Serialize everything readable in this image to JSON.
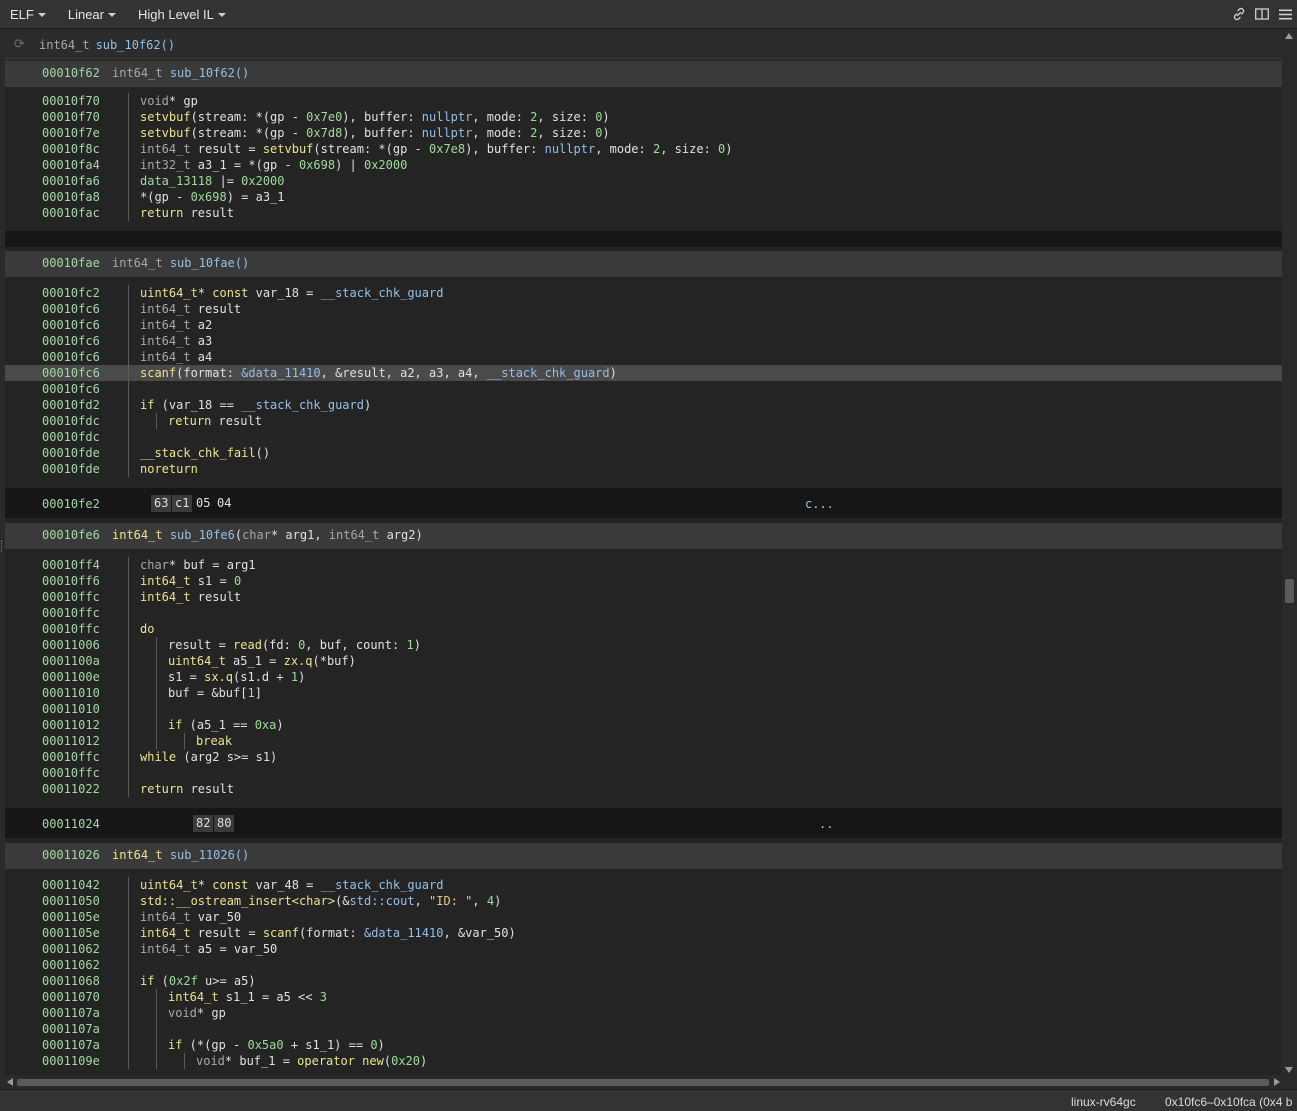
{
  "toolbar": {
    "menus": [
      {
        "label": "ELF"
      },
      {
        "label": "Linear"
      },
      {
        "label": "High Level IL"
      }
    ],
    "icons": [
      "link-icon",
      "split-view-icon",
      "hamburger-menu-icon"
    ]
  },
  "header": {
    "type": "int64_t",
    "name": "sub_10f62()"
  },
  "status": {
    "platform": "linux-rv64gc",
    "range": "0x10fc6–0x10fca (0x4 b"
  },
  "func1": {
    "addr": "00010f62",
    "ret": "int64_t",
    "name": "sub_10f62()",
    "lines": [
      {
        "addr": "00010f70"
      },
      {
        "addr": "00010f70"
      },
      {
        "addr": "00010f7e"
      },
      {
        "addr": "00010f8c"
      },
      {
        "addr": "00010fa4"
      },
      {
        "addr": "00010fa6"
      },
      {
        "addr": "00010fa8"
      },
      {
        "addr": "00010fac"
      }
    ]
  },
  "func2": {
    "addr": "00010fae",
    "ret": "int64_t",
    "name": "sub_10fae()",
    "lines": [
      {
        "addr": "00010fc2"
      },
      {
        "addr": "00010fc6"
      },
      {
        "addr": "00010fc6"
      },
      {
        "addr": "00010fc6"
      },
      {
        "addr": "00010fc6"
      },
      {
        "addr": "00010fc6"
      },
      {
        "addr": "00010fc6"
      },
      {
        "addr": "00010fd2"
      },
      {
        "addr": "00010fdc"
      },
      {
        "addr": "00010fdc"
      },
      {
        "addr": "00010fde"
      },
      {
        "addr": "00010fde"
      }
    ]
  },
  "data1": {
    "addr": "00010fe2",
    "bytes": [
      "63",
      "c1",
      "05",
      "04"
    ],
    "ascii": "c..."
  },
  "func3": {
    "addr": "00010fe6",
    "ret": "int64_t",
    "name": "sub_10fe6",
    "lines": [
      {
        "addr": "00010ff4"
      },
      {
        "addr": "00010ff6"
      },
      {
        "addr": "00010ffc"
      },
      {
        "addr": "00010ffc"
      },
      {
        "addr": "00010ffc"
      },
      {
        "addr": "00011006"
      },
      {
        "addr": "0001100a"
      },
      {
        "addr": "0001100e"
      },
      {
        "addr": "00011010"
      },
      {
        "addr": "00011010"
      },
      {
        "addr": "00011012"
      },
      {
        "addr": "00011012"
      },
      {
        "addr": "00010ffc"
      },
      {
        "addr": "00010ffc"
      },
      {
        "addr": "00011022"
      }
    ]
  },
  "data2": {
    "addr": "00011024",
    "bytes": [
      "82",
      "80"
    ],
    "ascii": ".."
  },
  "func4": {
    "addr": "00011026",
    "ret": "int64_t",
    "name": "sub_11026()",
    "lines": [
      {
        "addr": "00011042"
      },
      {
        "addr": "00011050"
      },
      {
        "addr": "0001105e"
      },
      {
        "addr": "0001105e"
      },
      {
        "addr": "00011062"
      },
      {
        "addr": "00011062"
      },
      {
        "addr": "00011068"
      },
      {
        "addr": "00011070"
      },
      {
        "addr": "0001107a"
      },
      {
        "addr": "0001107a"
      },
      {
        "addr": "0001107a"
      },
      {
        "addr": "0001109e"
      }
    ]
  },
  "code": {
    "f1": [
      [
        [
          "t-type",
          "void"
        ],
        [
          "",
          "* gp"
        ]
      ],
      [
        [
          "t-func",
          "setvbuf"
        ],
        [
          "",
          "(stream: *(gp - "
        ],
        [
          "t-num",
          "0x7e0"
        ],
        [
          "",
          "), buffer: "
        ],
        [
          "t-data",
          "nullptr"
        ],
        [
          "",
          ", mode: "
        ],
        [
          "t-num",
          "2"
        ],
        [
          "",
          ", size: "
        ],
        [
          "t-num",
          "0"
        ],
        [
          "",
          ")"
        ]
      ],
      [
        [
          "t-func",
          "setvbuf"
        ],
        [
          "",
          "(stream: *(gp - "
        ],
        [
          "t-num",
          "0x7d8"
        ],
        [
          "",
          "), buffer: "
        ],
        [
          "t-data",
          "nullptr"
        ],
        [
          "",
          ", mode: "
        ],
        [
          "t-num",
          "2"
        ],
        [
          "",
          ", size: "
        ],
        [
          "t-num",
          "0"
        ],
        [
          "",
          ")"
        ]
      ],
      [
        [
          "t-type",
          "int64_t"
        ],
        [
          "",
          " result = "
        ],
        [
          "t-func",
          "setvbuf"
        ],
        [
          "",
          "(stream: *(gp - "
        ],
        [
          "t-num",
          "0x7e8"
        ],
        [
          "",
          "), buffer: "
        ],
        [
          "t-data",
          "nullptr"
        ],
        [
          "",
          ", mode: "
        ],
        [
          "t-num",
          "2"
        ],
        [
          "",
          ", size: "
        ],
        [
          "t-num",
          "0"
        ],
        [
          "",
          ")"
        ]
      ],
      [
        [
          "t-type",
          "int32_t"
        ],
        [
          "",
          " a3_1 = *(gp - "
        ],
        [
          "t-num",
          "0x698"
        ],
        [
          "",
          ") | "
        ],
        [
          "t-num",
          "0x2000"
        ]
      ],
      [
        [
          "t-num",
          "data_13118"
        ],
        [
          "",
          " |= "
        ],
        [
          "t-num",
          "0x2000"
        ]
      ],
      [
        [
          "",
          "*(gp - "
        ],
        [
          "t-num",
          "0x698"
        ],
        [
          "",
          ") = a3_1"
        ]
      ],
      [
        [
          "t-kw",
          "return"
        ],
        [
          "",
          " result"
        ]
      ]
    ],
    "f2": [
      [
        [
          "t-kw",
          "uint64_t"
        ],
        [
          "",
          "* "
        ],
        [
          "t-kw",
          "const"
        ],
        [
          "",
          " var_18 = "
        ],
        [
          "t-data",
          "__stack_chk_guard"
        ]
      ],
      [
        [
          "t-type",
          "int64_t"
        ],
        [
          "",
          " result"
        ]
      ],
      [
        [
          "t-type",
          "int64_t"
        ],
        [
          "",
          " a2"
        ]
      ],
      [
        [
          "t-type",
          "int64_t"
        ],
        [
          "",
          " a3"
        ]
      ],
      [
        [
          "t-type",
          "int64_t"
        ],
        [
          "",
          " a4"
        ]
      ],
      [
        [
          "t-func",
          "scanf"
        ],
        [
          "",
          "(format: "
        ],
        [
          "t-data",
          "&data_11410"
        ],
        [
          "",
          ", &result, a2, a3, a4, "
        ],
        [
          "t-data",
          "__stack_chk_guard"
        ],
        [
          "",
          ")"
        ]
      ],
      [],
      [
        [
          "t-kw",
          "if"
        ],
        [
          "",
          " (var_18 == "
        ],
        [
          "t-data",
          "__stack_chk_guard"
        ],
        [
          "",
          ")"
        ]
      ],
      [
        [
          "t-kw",
          "return"
        ],
        [
          "",
          " result"
        ]
      ],
      [],
      [
        [
          "t-func",
          "__stack_chk_fail"
        ],
        [
          "",
          "()"
        ]
      ],
      [
        [
          "t-kw",
          "noreturn"
        ]
      ]
    ],
    "f3": [
      [
        [
          "t-type",
          "char"
        ],
        [
          "",
          "* buf = arg1"
        ]
      ],
      [
        [
          "t-kw",
          "int64_t"
        ],
        [
          "",
          " s1 = "
        ],
        [
          "t-num",
          "0"
        ]
      ],
      [
        [
          "t-kw",
          "int64_t"
        ],
        [
          "",
          " result"
        ]
      ],
      [],
      [
        [
          "t-kw",
          "do"
        ]
      ],
      [
        [
          "",
          "result = "
        ],
        [
          "t-func",
          "read"
        ],
        [
          "",
          "(fd: "
        ],
        [
          "t-num",
          "0"
        ],
        [
          "",
          ", buf, count: "
        ],
        [
          "t-num",
          "1"
        ],
        [
          "",
          ")"
        ]
      ],
      [
        [
          "t-kw",
          "uint64_t"
        ],
        [
          "",
          " a5_1 = "
        ],
        [
          "t-func",
          "zx.q"
        ],
        [
          "",
          "(*buf)"
        ]
      ],
      [
        [
          "",
          "s1 = "
        ],
        [
          "t-func",
          "sx.q"
        ],
        [
          "",
          "(s1.d + "
        ],
        [
          "t-num",
          "1"
        ],
        [
          "",
          ")"
        ]
      ],
      [
        [
          "",
          "buf = &buf["
        ],
        [
          "t-num",
          "1"
        ],
        [
          "",
          "]"
        ]
      ],
      [],
      [
        [
          "t-kw",
          "if"
        ],
        [
          "",
          " (a5_1 == "
        ],
        [
          "t-num",
          "0xa"
        ],
        [
          "",
          ")"
        ]
      ],
      [
        [
          "t-kw",
          "break"
        ]
      ],
      [
        [
          "t-kw",
          "while"
        ],
        [
          "",
          " (arg2 s>= s1)"
        ]
      ],
      [],
      [
        [
          "t-kw",
          "return"
        ],
        [
          "",
          " result"
        ]
      ]
    ],
    "f4": [
      [
        [
          "t-kw",
          "uint64_t"
        ],
        [
          "",
          "* "
        ],
        [
          "t-kw",
          "const"
        ],
        [
          "",
          " var_48 = "
        ],
        [
          "t-data",
          "__stack_chk_guard"
        ]
      ],
      [
        [
          "t-func",
          "std::__ostream_insert<char>"
        ],
        [
          "",
          "(&"
        ],
        [
          "t-data",
          "std::cout"
        ],
        [
          "",
          ", "
        ],
        [
          "t-str",
          "\"ID: \""
        ],
        [
          "",
          ", "
        ],
        [
          "t-num",
          "4"
        ],
        [
          "",
          ")"
        ]
      ],
      [
        [
          "t-type",
          "int64_t"
        ],
        [
          "",
          " var_50"
        ]
      ],
      [
        [
          "t-kw",
          "int64_t"
        ],
        [
          "",
          " result = "
        ],
        [
          "t-func",
          "scanf"
        ],
        [
          "",
          "(format: "
        ],
        [
          "t-data",
          "&data_11410"
        ],
        [
          "",
          ", &var_50)"
        ]
      ],
      [
        [
          "t-type",
          "int64_t"
        ],
        [
          "",
          " a5 = var_50"
        ]
      ],
      [],
      [
        [
          "t-kw",
          "if"
        ],
        [
          "",
          " ("
        ],
        [
          "t-num",
          "0x2f"
        ],
        [
          "",
          " u>= a5)"
        ]
      ],
      [
        [
          "t-kw",
          "int64_t"
        ],
        [
          "",
          " s1_1 = a5 << "
        ],
        [
          "t-num",
          "3"
        ]
      ],
      [
        [
          "t-type",
          "void"
        ],
        [
          "",
          "* gp"
        ]
      ],
      [],
      [
        [
          "t-kw",
          "if"
        ],
        [
          "",
          " (*(gp - "
        ],
        [
          "t-num",
          "0x5a0"
        ],
        [
          "",
          " + s1_1) == "
        ],
        [
          "t-num",
          "0"
        ],
        [
          "",
          ")"
        ]
      ],
      [
        [
          "t-type",
          "void"
        ],
        [
          "",
          "* buf_1 = "
        ],
        [
          "t-func",
          "operator new"
        ],
        [
          "",
          "("
        ],
        [
          "t-num",
          "0x20"
        ],
        [
          "",
          ")"
        ]
      ]
    ],
    "f3_params": [
      [
        [
          "t-type",
          "char"
        ],
        [
          "",
          "* arg1, "
        ],
        [
          "t-type",
          "int64_t"
        ],
        [
          "",
          " arg2"
        ]
      ]
    ]
  }
}
